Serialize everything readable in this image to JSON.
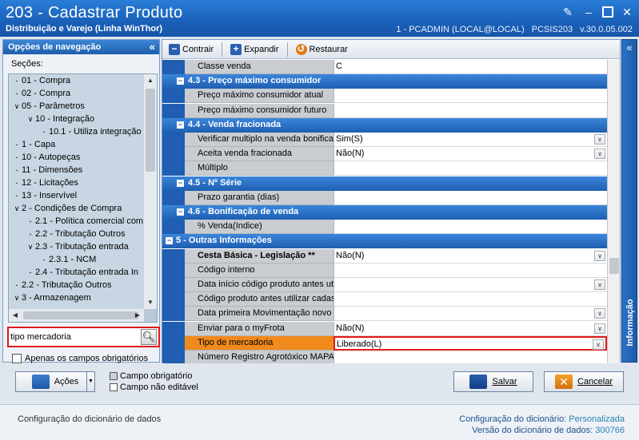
{
  "window": {
    "title": "203 - Cadastrar  Produto",
    "subtitle": "Distribuição e Varejo (Linha WinThor)",
    "connection": "1 - PCADMIN (LOCAL@LOCAL)",
    "program": "PCSIS203",
    "version": "v.30.0.05.002"
  },
  "nav": {
    "header": "Opções de navegação",
    "sections_label": "Seções:",
    "items": [
      {
        "label": "01 - Compra",
        "level": 0,
        "toggle": ""
      },
      {
        "label": "02 - Compra",
        "level": 0,
        "toggle": ""
      },
      {
        "label": "05 - Parâmetros",
        "level": 0,
        "toggle": "v"
      },
      {
        "label": "10 - Integração",
        "level": 1,
        "toggle": "v"
      },
      {
        "label": "10.1 - Utiliza integração",
        "level": 2,
        "toggle": ""
      },
      {
        "label": "1 - Capa",
        "level": 0,
        "toggle": ""
      },
      {
        "label": "10 - Autopeças",
        "level": 0,
        "toggle": ""
      },
      {
        "label": "11 - Dimensões",
        "level": 0,
        "toggle": ""
      },
      {
        "label": "12 - Licitações",
        "level": 0,
        "toggle": ""
      },
      {
        "label": "13 - Inservível",
        "level": 0,
        "toggle": ""
      },
      {
        "label": "2 - Condições de Compra",
        "level": 0,
        "toggle": "v"
      },
      {
        "label": "2.1 - Política comercial com",
        "level": 1,
        "toggle": ""
      },
      {
        "label": "2.2 - Tributação Outros",
        "level": 1,
        "toggle": ""
      },
      {
        "label": "2.3 - Tributação entrada",
        "level": 1,
        "toggle": "v"
      },
      {
        "label": "2.3.1 - NCM",
        "level": 2,
        "toggle": ""
      },
      {
        "label": "2.4 - Tributação entrada In",
        "level": 1,
        "toggle": ""
      },
      {
        "label": "2.2 - Tributação Outros",
        "level": 0,
        "toggle": ""
      },
      {
        "label": "3 - Armazenagem",
        "level": 0,
        "toggle": "v"
      }
    ],
    "search_value": "tipo mercadoria",
    "search_placeholder": "",
    "required_only_label": "Apenas os campos obrigatórios"
  },
  "toolbar": {
    "collapse_label": "Contrair",
    "expand_label": "Expandir",
    "restore_label": "Restaurar"
  },
  "grid": {
    "rows": [
      {
        "kind": "field",
        "name": "Classe venda",
        "value": "C",
        "dropdown": false
      },
      {
        "kind": "section",
        "name": "4.3 - Preço máximo consumidor"
      },
      {
        "kind": "field",
        "name": "Preço máximo consumidor atual",
        "value": "",
        "dropdown": false
      },
      {
        "kind": "field",
        "name": "Preço máximo consumidor futuro",
        "value": "",
        "dropdown": false
      },
      {
        "kind": "section",
        "name": "4.4 - Venda fracionada"
      },
      {
        "kind": "field",
        "name": "Verificar multiplo na venda bonifica",
        "value": "Sim(S)",
        "dropdown": true
      },
      {
        "kind": "field",
        "name": "Aceita venda fracionada",
        "value": "Não(N)",
        "dropdown": true
      },
      {
        "kind": "field",
        "name": "Múltiplo",
        "value": "",
        "dropdown": false
      },
      {
        "kind": "section",
        "name": "4.5 - Nº Série"
      },
      {
        "kind": "field",
        "name": "Prazo garantia (dias)",
        "value": "",
        "dropdown": false
      },
      {
        "kind": "section",
        "name": "4.6 - Bonificação de venda"
      },
      {
        "kind": "field",
        "name": "% Venda(Indice)",
        "value": "",
        "dropdown": false
      },
      {
        "kind": "section",
        "name": "5 - Outras Informações",
        "top": true
      },
      {
        "kind": "field",
        "name": "Cesta Básica - Legislação **",
        "value": "Não(N)",
        "dropdown": true,
        "bold": true
      },
      {
        "kind": "field",
        "name": "Código interno",
        "value": "",
        "dropdown": false
      },
      {
        "kind": "field",
        "name": "Data início código produto antes utiliz",
        "value": "",
        "dropdown": true
      },
      {
        "kind": "field",
        "name": "Código produto antes utilizar cadastro",
        "value": "",
        "dropdown": false
      },
      {
        "kind": "field",
        "name": "Data primeira Movimentação novo cód",
        "value": "",
        "dropdown": true
      },
      {
        "kind": "field",
        "name": "Enviar para o myFrota",
        "value": "Não(N)",
        "dropdown": true
      },
      {
        "kind": "field",
        "name": "Tipo de mercadoria",
        "value": "Liberado(L)",
        "dropdown": true,
        "highlight": true
      },
      {
        "kind": "field",
        "name": "Número Registro Agrotóxico MAPA",
        "value": "",
        "dropdown": false
      }
    ]
  },
  "info_tab": {
    "label": "Informação"
  },
  "buttons": {
    "actions_label": "Ações",
    "save_label": "Salvar",
    "cancel_label": "Cancelar"
  },
  "legend": {
    "required_label": "Campo obrigatório",
    "readonly_label": "Campo não editável"
  },
  "status": {
    "left": "Configuração do dicionário de dados",
    "dict_config_label": "Configuração do dicionário:",
    "dict_config_value": "Personalizada",
    "dict_version_label": "Versão do dicionário de dados:",
    "dict_version_value": "300766"
  },
  "colors": {
    "title_blue": "#1f5eb0",
    "highlight_orange": "#f08a1c",
    "focus_red": "#e01818"
  }
}
